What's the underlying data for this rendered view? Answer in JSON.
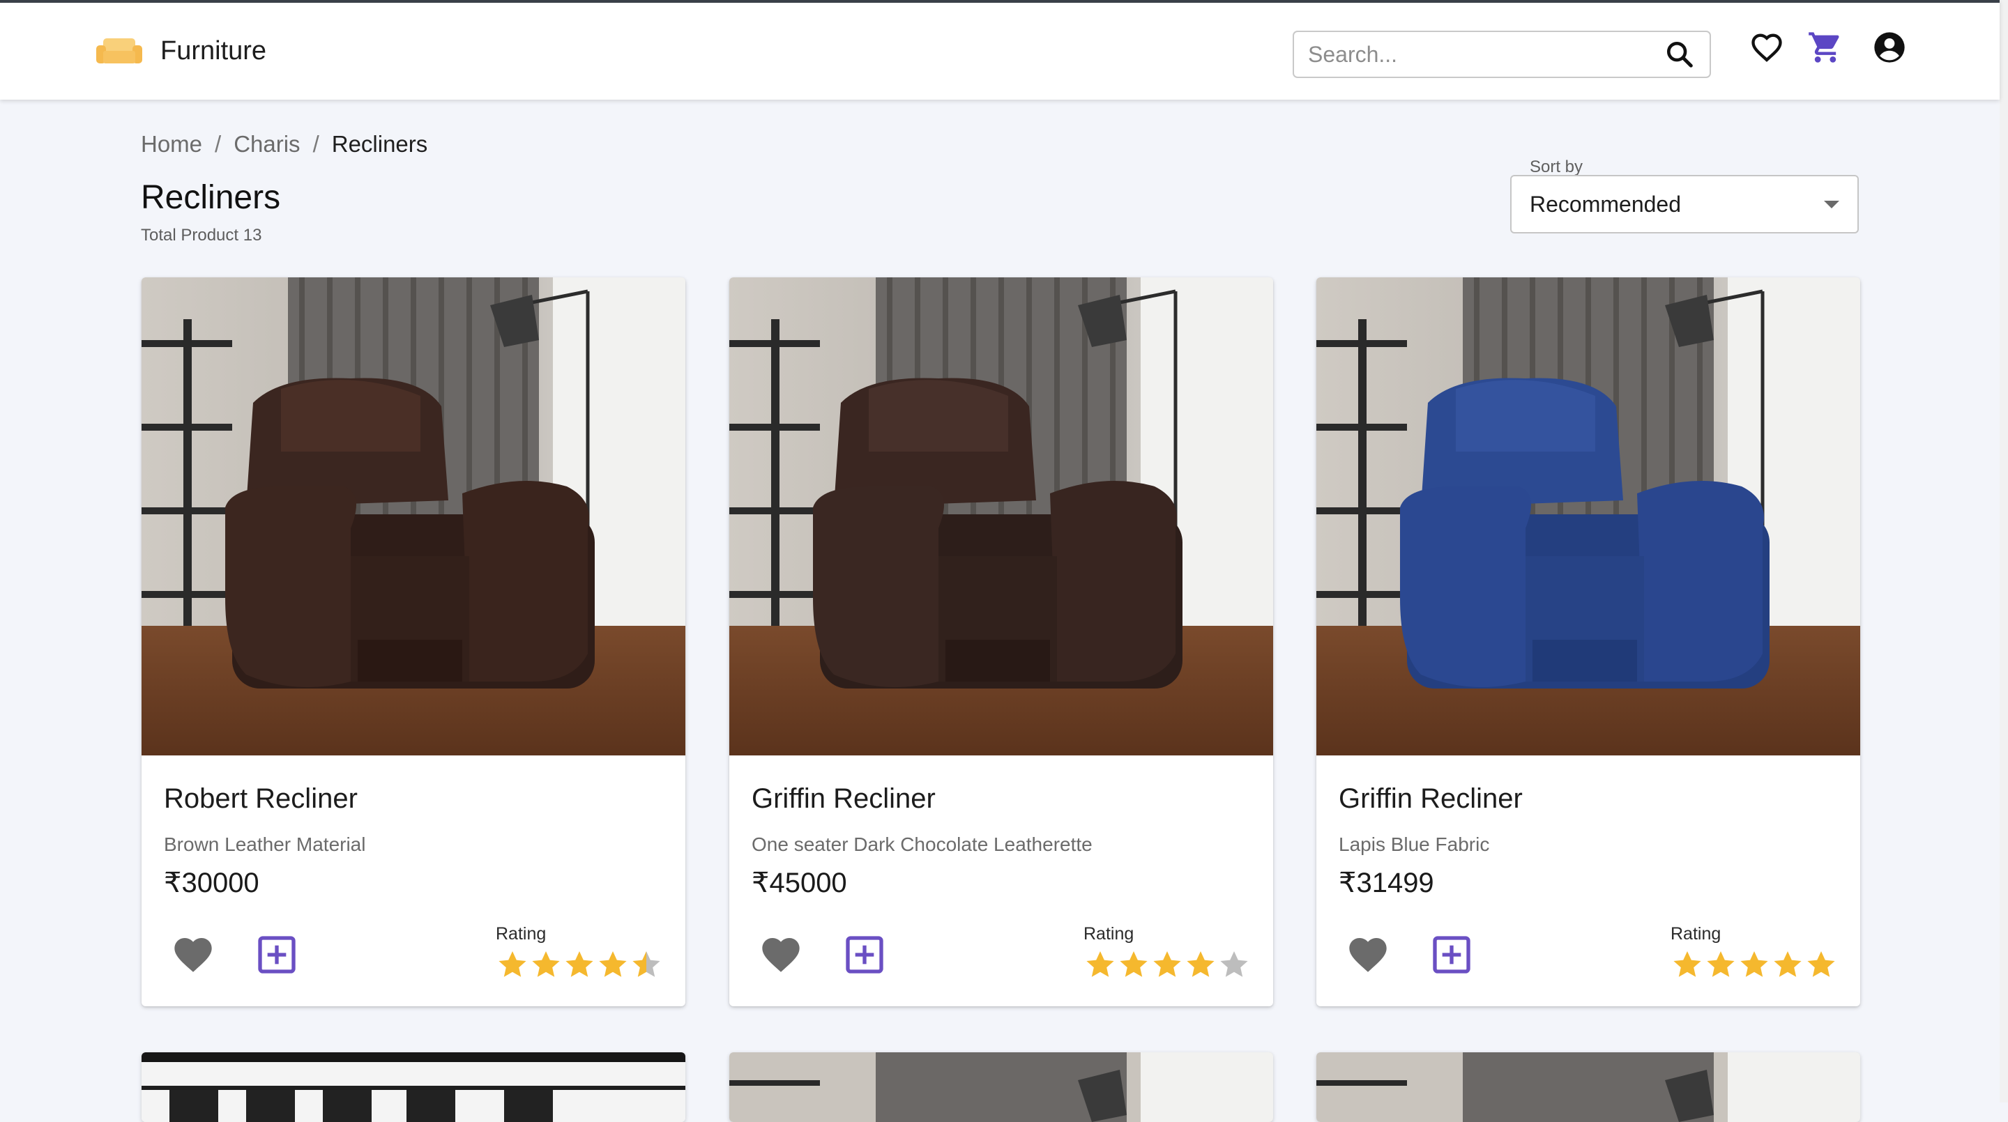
{
  "brand": {
    "name": "Furniture",
    "icon": "sofa-icon",
    "icon_color": "#f7c25f"
  },
  "search": {
    "placeholder": "Search...",
    "value": ""
  },
  "header_icons": [
    "heart-icon",
    "cart-icon",
    "account-icon"
  ],
  "accent_color": "#6a4fc3",
  "breadcrumb": [
    "Home",
    "Charis",
    "Recliners"
  ],
  "page": {
    "title": "Recliners",
    "total_label": "Total Product 13"
  },
  "sort": {
    "label": "Sort by",
    "value": "Recommended"
  },
  "products": [
    {
      "name": "Robert Recliner",
      "description": "Brown Leather Material",
      "price": "₹30000",
      "rating_label": "Rating",
      "rating": 4.5,
      "image": "brown-leather-recliner"
    },
    {
      "name": "Griffin Recliner",
      "description": "One seater Dark Chocolate Leatherette",
      "price": "₹45000",
      "rating_label": "Rating",
      "rating": 4,
      "image": "dark-chocolate-recliner"
    },
    {
      "name": "Griffin Recliner",
      "description": "Lapis Blue Fabric",
      "price": "₹31499",
      "rating_label": "Rating",
      "rating": 5,
      "image": "blue-fabric-recliner"
    }
  ],
  "colors": {
    "star": "#f5b82e",
    "star_empty": "#bdbdbd",
    "heart": "#6b6b6b"
  }
}
